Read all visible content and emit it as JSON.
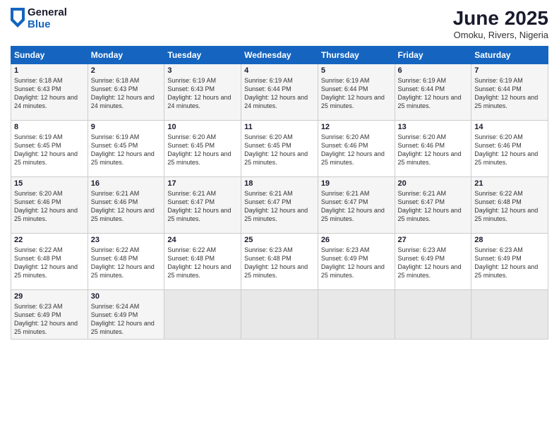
{
  "logo": {
    "general": "General",
    "blue": "Blue"
  },
  "title": {
    "month_year": "June 2025",
    "location": "Omoku, Rivers, Nigeria"
  },
  "days_header": [
    "Sunday",
    "Monday",
    "Tuesday",
    "Wednesday",
    "Thursday",
    "Friday",
    "Saturday"
  ],
  "weeks": [
    [
      {
        "day": "1",
        "rise": "6:18 AM",
        "set": "6:43 PM",
        "daylight": "12 hours and 24 minutes."
      },
      {
        "day": "2",
        "rise": "6:18 AM",
        "set": "6:43 PM",
        "daylight": "12 hours and 24 minutes."
      },
      {
        "day": "3",
        "rise": "6:19 AM",
        "set": "6:43 PM",
        "daylight": "12 hours and 24 minutes."
      },
      {
        "day": "4",
        "rise": "6:19 AM",
        "set": "6:44 PM",
        "daylight": "12 hours and 24 minutes."
      },
      {
        "day": "5",
        "rise": "6:19 AM",
        "set": "6:44 PM",
        "daylight": "12 hours and 25 minutes."
      },
      {
        "day": "6",
        "rise": "6:19 AM",
        "set": "6:44 PM",
        "daylight": "12 hours and 25 minutes."
      },
      {
        "day": "7",
        "rise": "6:19 AM",
        "set": "6:44 PM",
        "daylight": "12 hours and 25 minutes."
      }
    ],
    [
      {
        "day": "8",
        "rise": "6:19 AM",
        "set": "6:45 PM",
        "daylight": "12 hours and 25 minutes."
      },
      {
        "day": "9",
        "rise": "6:19 AM",
        "set": "6:45 PM",
        "daylight": "12 hours and 25 minutes."
      },
      {
        "day": "10",
        "rise": "6:20 AM",
        "set": "6:45 PM",
        "daylight": "12 hours and 25 minutes."
      },
      {
        "day": "11",
        "rise": "6:20 AM",
        "set": "6:45 PM",
        "daylight": "12 hours and 25 minutes."
      },
      {
        "day": "12",
        "rise": "6:20 AM",
        "set": "6:46 PM",
        "daylight": "12 hours and 25 minutes."
      },
      {
        "day": "13",
        "rise": "6:20 AM",
        "set": "6:46 PM",
        "daylight": "12 hours and 25 minutes."
      },
      {
        "day": "14",
        "rise": "6:20 AM",
        "set": "6:46 PM",
        "daylight": "12 hours and 25 minutes."
      }
    ],
    [
      {
        "day": "15",
        "rise": "6:20 AM",
        "set": "6:46 PM",
        "daylight": "12 hours and 25 minutes."
      },
      {
        "day": "16",
        "rise": "6:21 AM",
        "set": "6:46 PM",
        "daylight": "12 hours and 25 minutes."
      },
      {
        "day": "17",
        "rise": "6:21 AM",
        "set": "6:47 PM",
        "daylight": "12 hours and 25 minutes."
      },
      {
        "day": "18",
        "rise": "6:21 AM",
        "set": "6:47 PM",
        "daylight": "12 hours and 25 minutes."
      },
      {
        "day": "19",
        "rise": "6:21 AM",
        "set": "6:47 PM",
        "daylight": "12 hours and 25 minutes."
      },
      {
        "day": "20",
        "rise": "6:21 AM",
        "set": "6:47 PM",
        "daylight": "12 hours and 25 minutes."
      },
      {
        "day": "21",
        "rise": "6:22 AM",
        "set": "6:48 PM",
        "daylight": "12 hours and 25 minutes."
      }
    ],
    [
      {
        "day": "22",
        "rise": "6:22 AM",
        "set": "6:48 PM",
        "daylight": "12 hours and 25 minutes."
      },
      {
        "day": "23",
        "rise": "6:22 AM",
        "set": "6:48 PM",
        "daylight": "12 hours and 25 minutes."
      },
      {
        "day": "24",
        "rise": "6:22 AM",
        "set": "6:48 PM",
        "daylight": "12 hours and 25 minutes."
      },
      {
        "day": "25",
        "rise": "6:23 AM",
        "set": "6:48 PM",
        "daylight": "12 hours and 25 minutes."
      },
      {
        "day": "26",
        "rise": "6:23 AM",
        "set": "6:49 PM",
        "daylight": "12 hours and 25 minutes."
      },
      {
        "day": "27",
        "rise": "6:23 AM",
        "set": "6:49 PM",
        "daylight": "12 hours and 25 minutes."
      },
      {
        "day": "28",
        "rise": "6:23 AM",
        "set": "6:49 PM",
        "daylight": "12 hours and 25 minutes."
      }
    ],
    [
      {
        "day": "29",
        "rise": "6:23 AM",
        "set": "6:49 PM",
        "daylight": "12 hours and 25 minutes."
      },
      {
        "day": "30",
        "rise": "6:24 AM",
        "set": "6:49 PM",
        "daylight": "12 hours and 25 minutes."
      },
      {
        "day": "",
        "rise": "",
        "set": "",
        "daylight": ""
      },
      {
        "day": "",
        "rise": "",
        "set": "",
        "daylight": ""
      },
      {
        "day": "",
        "rise": "",
        "set": "",
        "daylight": ""
      },
      {
        "day": "",
        "rise": "",
        "set": "",
        "daylight": ""
      },
      {
        "day": "",
        "rise": "",
        "set": "",
        "daylight": ""
      }
    ]
  ]
}
